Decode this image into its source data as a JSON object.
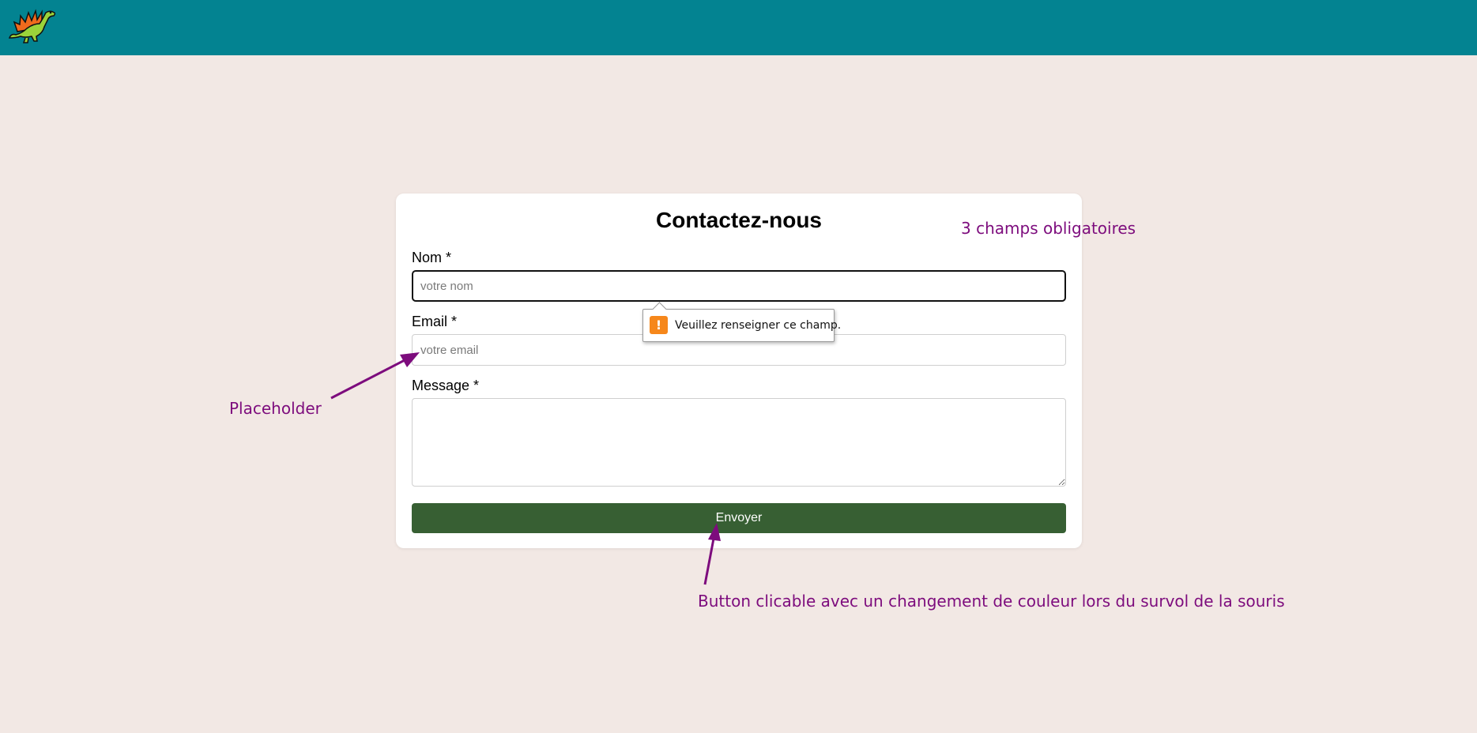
{
  "header": {
    "logo_icon": "dinosaur-icon",
    "background": "#038391"
  },
  "form": {
    "title": "Contactez-nous",
    "name_label": "Nom *",
    "name_placeholder": "votre nom",
    "name_value": "",
    "email_label": "Email *",
    "email_placeholder": "votre email",
    "email_value": "",
    "message_label": "Message *",
    "message_value": "",
    "submit_label": "Envoyer",
    "submit_color": "#375f33"
  },
  "validation": {
    "icon": "warning-icon",
    "icon_color": "#f6871b",
    "message": "Veuillez renseigner ce champ."
  },
  "annotations": {
    "required_fields": "3 champs obligatoires",
    "placeholder": "Placeholder",
    "button": "Button clicable avec un changement de couleur lors du survol de la souris",
    "color": "#7d0c7d"
  }
}
